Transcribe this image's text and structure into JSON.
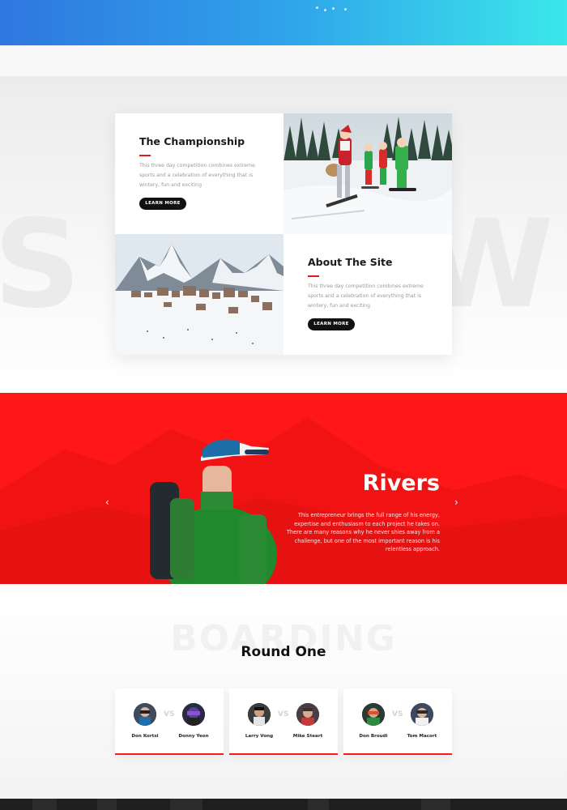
{
  "championship": {
    "title": "The Championship",
    "text": "This three day competition combines extreme sports and a celebration of everything that is wintery, fun and exciting",
    "button": "LEARN MORE"
  },
  "about": {
    "title": "About The Site",
    "text": "This three day competition combines extreme sports and a celebration of everything that is wintery, fun and exciting",
    "button": "LEARN MORE"
  },
  "feature": {
    "name": "Rivers",
    "text": "This entrepreneur brings the full range of his energy, expertise and enthusiasm to each project he takes on. There are many reasons why he never shies away from a challenge, but one of the most important reason is his relentless approach."
  },
  "round": {
    "background_word": "BOARDING",
    "title": "Round One",
    "vs_label": "VS",
    "matches": [
      {
        "player_a": "Don Kortsi",
        "player_b": "Donny Yeon"
      },
      {
        "player_a": "Larry Vong",
        "player_b": "Mike Steart"
      },
      {
        "player_a": "Don Broudi",
        "player_b": "Tom Macort"
      }
    ]
  },
  "icons": {
    "prev": "chevron-left-icon",
    "next": "chevron-right-icon"
  },
  "colors": {
    "accent": "#ff1616",
    "hero_start": "#2f77e0",
    "hero_end": "#3be7ea",
    "button": "#111111"
  }
}
